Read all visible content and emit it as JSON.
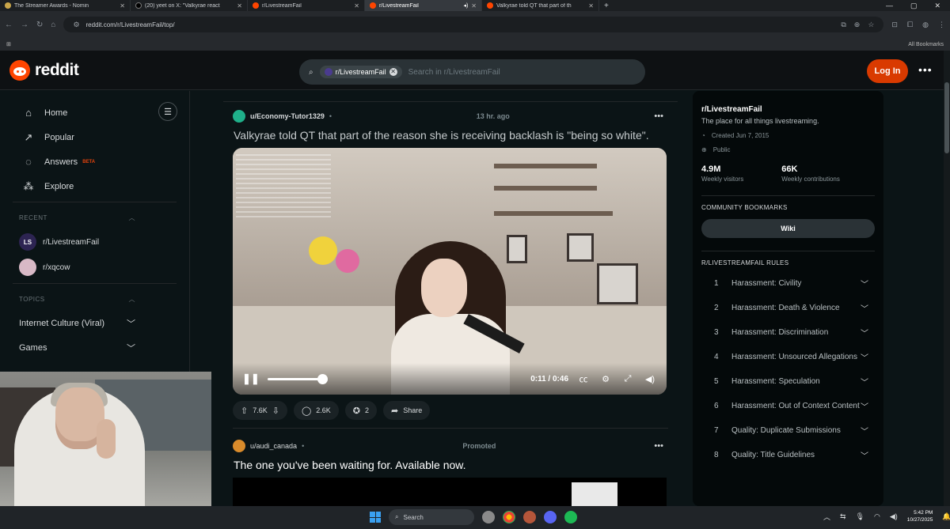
{
  "browser": {
    "tabs": [
      {
        "label": "The Streamer Awards - Nomin",
        "icon": "trophy-favicon"
      },
      {
        "label": "(20) yeet on X: \"Valkyrae react",
        "icon": "x-favicon"
      },
      {
        "label": "r/LivestreamFail",
        "icon": "reddit-favicon"
      },
      {
        "label": "r/LivestreamFail",
        "icon": "reddit-favicon"
      },
      {
        "label": "Valkyrae told QT that part of th",
        "icon": "reddit-favicon"
      }
    ],
    "new_tab": "+",
    "url": "reddit.com/r/LivestreamFail/top/",
    "bookmarks_label": "All Bookmarks"
  },
  "header": {
    "logo_text": "reddit",
    "search_chip": "r/LivestreamFail",
    "search_placeholder": "Search in r/LivestreamFail",
    "login_label": "Log In",
    "more": "•••"
  },
  "sidebar": {
    "nav": [
      {
        "label": "Home",
        "icon": "home-icon",
        "glyph": "⌂"
      },
      {
        "label": "Popular",
        "icon": "popular-icon",
        "glyph": "↗"
      },
      {
        "label": "Answers",
        "icon": "answers-icon",
        "glyph": "◌",
        "badge": "BETA"
      },
      {
        "label": "Explore",
        "icon": "explore-icon",
        "glyph": "⁂"
      }
    ],
    "recent_header": "RECENT",
    "recent": [
      {
        "label": "r/LivestreamFail",
        "avatar": "LS"
      },
      {
        "label": "r/xqcow",
        "avatar": ""
      }
    ],
    "topics_header": "TOPICS",
    "topics": [
      "Internet Culture (Viral)",
      "Games"
    ]
  },
  "post": {
    "user": "u/Economy-Tutor1329",
    "separator": "•",
    "time": "13 hr. ago",
    "title": "Valkyrae told QT that part of the reason she is receiving backlash is \"being so white\".",
    "video": {
      "time": "0:11 / 0:46",
      "progress": 0.24
    },
    "upvotes": "7.6K",
    "comments": "2.6K",
    "awards": "2",
    "share": "Share"
  },
  "promo": {
    "user": "u/audi_canada",
    "separator": "•",
    "tag": "Promoted",
    "title": "The one you've been waiting for. Available now."
  },
  "community": {
    "name": "r/LivestreamFail",
    "description": "The place for all things livestreaming.",
    "created": "Created Jun 7, 2015",
    "visibility": "Public",
    "stats": [
      {
        "num": "4.9M",
        "label": "Weekly visitors"
      },
      {
        "num": "66K",
        "label": "Weekly contributions"
      }
    ],
    "bookmarks_header": "COMMUNITY BOOKMARKS",
    "wiki": "Wiki",
    "rules_header": "R/LIVESTREAMFAIL RULES",
    "rules": [
      {
        "n": "1",
        "text": "Harassment: Civility"
      },
      {
        "n": "2",
        "text": "Harassment: Death & Violence"
      },
      {
        "n": "3",
        "text": "Harassment: Discrimination"
      },
      {
        "n": "4",
        "text": "Harassment: Unsourced Allegations"
      },
      {
        "n": "5",
        "text": "Harassment: Speculation"
      },
      {
        "n": "6",
        "text": "Harassment: Out of Context Content"
      },
      {
        "n": "7",
        "text": "Quality: Duplicate Submissions"
      },
      {
        "n": "8",
        "text": "Quality: Title Guidelines"
      }
    ]
  },
  "taskbar": {
    "search": "Search",
    "time": "5:42 PM",
    "date": "10/27/2025"
  }
}
